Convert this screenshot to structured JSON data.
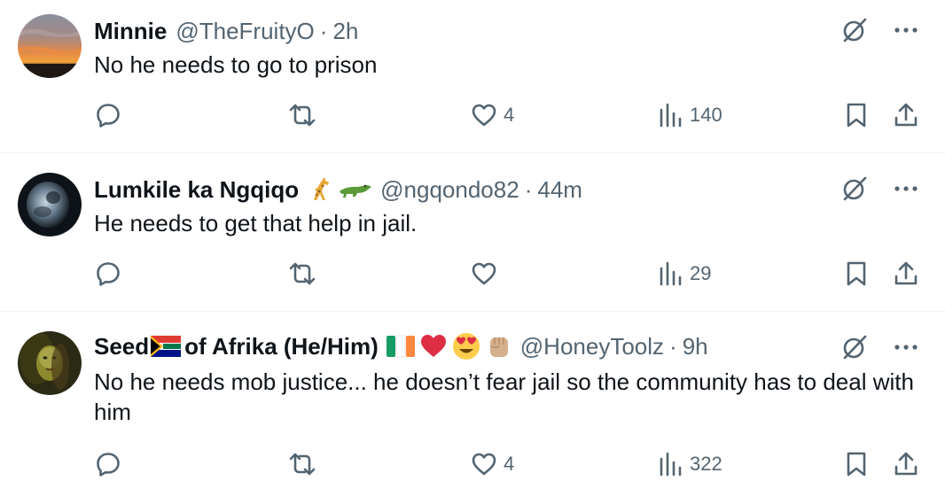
{
  "tweets": [
    {
      "name": "Minnie",
      "handle": "@TheFruityO",
      "separator": "·",
      "time": "2h",
      "text": "No he needs to go to prison",
      "like_count": "4",
      "view_count": "140"
    },
    {
      "name": "Lumkile ka Ngqiqo",
      "name_emojis": [
        "giraffe",
        "crocodile"
      ],
      "handle": "@ngqondo82",
      "separator": "·",
      "time": "44m",
      "text": "He needs to get that help in jail.",
      "like_count": "",
      "view_count": "29"
    },
    {
      "name_part1": "Seed",
      "name_part2": "of Afrika (He/Him)",
      "name_emojis": [
        "south-africa-flag",
        "ireland-flag",
        "red-heart",
        "heart-eyes-face",
        "raised-fist"
      ],
      "handle": "@HoneyToolz",
      "separator": "·",
      "time": "9h",
      "text": "No he needs mob justice... he doesn’t fear jail so the community has to deal with him",
      "like_count": "4",
      "view_count": "322"
    }
  ],
  "colors": {
    "text": "#0f1419",
    "secondary": "#536471",
    "divider": "#eff3f4"
  }
}
